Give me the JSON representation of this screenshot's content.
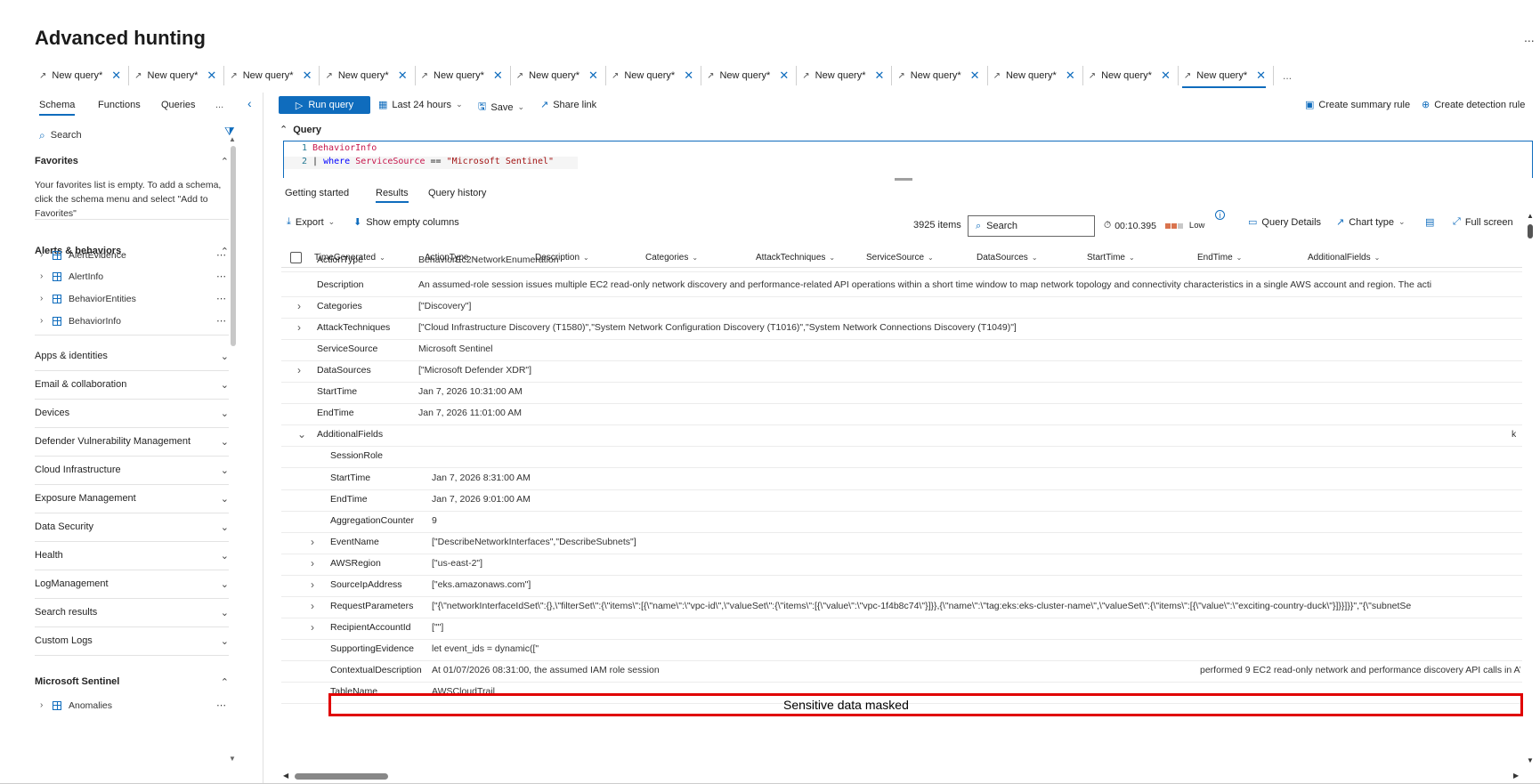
{
  "page": {
    "title": "Advanced hunting",
    "more": "..."
  },
  "tabs": {
    "items": [
      {
        "label": "New query*"
      },
      {
        "label": "New query*"
      },
      {
        "label": "New query*"
      },
      {
        "label": "New query*"
      },
      {
        "label": "New query*"
      },
      {
        "label": "New query*"
      },
      {
        "label": "New query*"
      },
      {
        "label": "New query*"
      },
      {
        "label": "New query*"
      },
      {
        "label": "New query*"
      },
      {
        "label": "New query*"
      },
      {
        "label": "New query*"
      },
      {
        "label": "New query*"
      }
    ],
    "active_index": 12,
    "more": "..."
  },
  "left_panel": {
    "tabs": [
      "Schema",
      "Functions",
      "Queries"
    ],
    "more": "...",
    "search_placeholder": "Search",
    "favorites": {
      "title": "Favorites",
      "empty_text": "Your favorites list is empty. To add a schema, click the schema menu and select \"Add to Favorites\""
    },
    "alerts": {
      "title": "Alerts & behaviors",
      "items": [
        "AlertEvidence",
        "AlertInfo",
        "BehaviorEntities",
        "BehaviorInfo"
      ]
    },
    "sections": [
      "Apps & identities",
      "Email & collaboration",
      "Devices",
      "Defender Vulnerability Management",
      "Cloud Infrastructure",
      "Exposure Management",
      "Data Security",
      "Health",
      "LogManagement",
      "Search results",
      "Custom Logs"
    ],
    "sentinel": {
      "title": "Microsoft Sentinel",
      "items": [
        "Anomalies"
      ]
    }
  },
  "toolbar": {
    "run": "Run query",
    "time_range": "Last 24 hours",
    "save": "Save",
    "share": "Share link",
    "summary_rule": "Create summary rule",
    "detection_rule": "Create detection rule"
  },
  "query": {
    "label": "Query",
    "lines": [
      {
        "num": "1",
        "table": "BehaviorInfo"
      },
      {
        "num": "2",
        "pipe": "|",
        "kw": "where",
        "field": "ServiceSource",
        "op": "==",
        "str": "\"Microsoft Sentinel\""
      }
    ]
  },
  "results_tabs": [
    "Getting started",
    "Results",
    "Query history"
  ],
  "results_toolbar": {
    "export": "Export",
    "show_empty": "Show empty columns",
    "items_count": "3925 items",
    "search_placeholder": "Search",
    "elapsed": "00:10.395",
    "load": "Low",
    "details": "Query Details",
    "chart_type": "Chart type",
    "full_screen": "Full screen",
    "colors": {
      "load_bar_on": "#d9734e",
      "load_bar_off": "#c8c8c8",
      "accent": "#0f6cbd",
      "mask": "#e00000"
    }
  },
  "columns": [
    "TimeGenerated",
    "ActionType",
    "Description",
    "Categories",
    "AttackTechniques",
    "ServiceSource",
    "DataSources",
    "StartTime",
    "EndTime",
    "AdditionalFields"
  ],
  "rows": {
    "action_type": {
      "key": "ActionType",
      "value": "BehaviorEc2NetworkEnumeration"
    },
    "description": {
      "key": "Description",
      "value": "An assumed-role session issues multiple EC2 read-only network discovery and performance-related API operations within a short time window to map network topology and connectivity characteristics in a single AWS account and region. The acti"
    },
    "categories": {
      "key": "Categories",
      "value": "[\"Discovery\"]"
    },
    "attack_techniques": {
      "key": "AttackTechniques",
      "value": "[\"Cloud Infrastructure Discovery (T1580)\",\"System Network Configuration Discovery (T1016)\",\"System Network Connections Discovery (T1049)\"]"
    },
    "service_source": {
      "key": "ServiceSource",
      "value": "Microsoft Sentinel"
    },
    "data_sources": {
      "key": "DataSources",
      "value": "[\"Microsoft Defender XDR\"]"
    },
    "start_time": {
      "key": "StartTime",
      "value": "Jan 7, 2026 10:31:00 AM"
    },
    "end_time": {
      "key": "EndTime",
      "value": "Jan 7, 2026 11:01:00 AM"
    },
    "additional_fields": {
      "key": "AdditionalFields",
      "value": "k"
    },
    "session_role": {
      "key": "SessionRole",
      "value": ""
    },
    "af_start": {
      "key": "StartTime",
      "value": "Jan 7, 2026 8:31:00 AM"
    },
    "af_end": {
      "key": "EndTime",
      "value": "Jan 7, 2026 9:01:00 AM"
    },
    "agg_counter": {
      "key": "AggregationCounter",
      "value": "9"
    },
    "event_name": {
      "key": "EventName",
      "value": "[\"DescribeNetworkInterfaces\",\"DescribeSubnets\"]"
    },
    "aws_region": {
      "key": "AWSRegion",
      "value": "[\"us-east-2\"]"
    },
    "source_ip": {
      "key": "SourceIpAddress",
      "value": "[\"eks.amazonaws.com\"]"
    },
    "request_params": {
      "key": "RequestParameters",
      "value": "[\"{\\\"networkInterfaceIdSet\\\":{},\\\"filterSet\\\":{\\\"items\\\":[{\\\"name\\\":\\\"vpc-id\\\",\\\"valueSet\\\":{\\\"items\\\":[{\\\"value\\\":\\\"vpc-1f4b8c74\\\"}]}},{\\\"name\\\":\\\"tag:eks:eks-cluster-name\\\",\\\"valueSet\\\":{\\\"items\\\":[{\\\"value\\\":\\\"exciting-country-duck\\\"}]}}]}}\",\"{\\\"subnetSe"
    },
    "recipient_account": {
      "key": "RecipientAccountId",
      "value": "[\"\"]"
    },
    "supporting_evidence": {
      "key": "SupportingEvidence",
      "value": "let event_ids = dynamic([\""
    },
    "contextual_desc": {
      "key": "ContextualDescription",
      "value": "At 01/07/2026 08:31:00, the assumed IAM role session",
      "value_right": "performed 9 EC2 read-only network and performance discovery API calls in AWS acc"
    },
    "table_name": {
      "key": "TableName",
      "value": "AWSCloudTrail"
    }
  },
  "mask_label": "Sensitive data masked"
}
